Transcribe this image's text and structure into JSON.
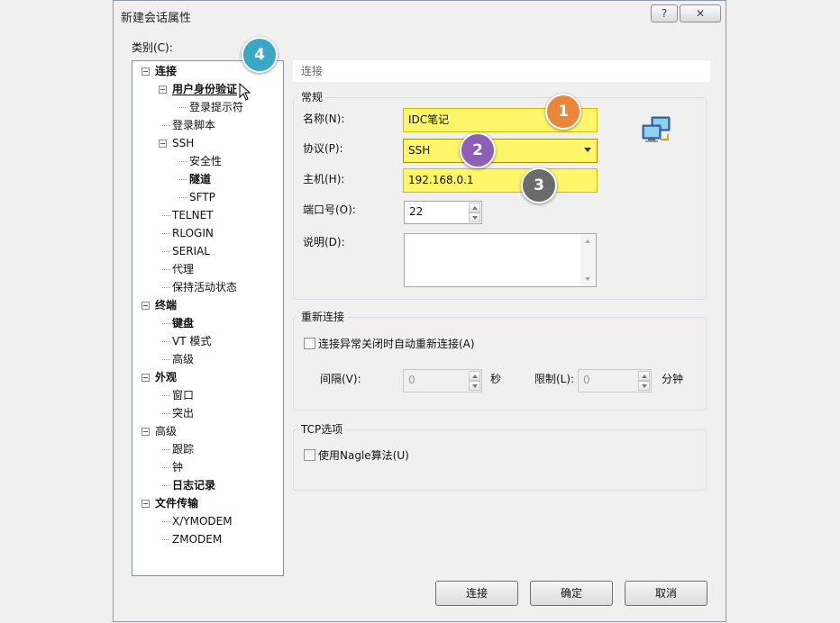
{
  "window": {
    "title": "新建会话属性",
    "help_label": "?",
    "close_label": "✕"
  },
  "category_label": "类别(C):",
  "tree": [
    {
      "label": "连接",
      "level": 0,
      "bold": true,
      "expander": "minus"
    },
    {
      "label": "用户身份验证",
      "level": 1,
      "bold": true,
      "expander": "minus",
      "selected": true
    },
    {
      "label": "登录提示符",
      "level": 2
    },
    {
      "label": "登录脚本",
      "level": 1
    },
    {
      "label": "SSH",
      "level": 1,
      "expander": "minus"
    },
    {
      "label": "安全性",
      "level": 2
    },
    {
      "label": "隧道",
      "level": 2,
      "bold": true
    },
    {
      "label": "SFTP",
      "level": 2
    },
    {
      "label": "TELNET",
      "level": 1
    },
    {
      "label": "RLOGIN",
      "level": 1
    },
    {
      "label": "SERIAL",
      "level": 1
    },
    {
      "label": "代理",
      "level": 1
    },
    {
      "label": "保持活动状态",
      "level": 1
    },
    {
      "label": "终端",
      "level": 0,
      "bold": true,
      "expander": "minus"
    },
    {
      "label": "键盘",
      "level": 1,
      "bold": true
    },
    {
      "label": "VT 模式",
      "level": 1
    },
    {
      "label": "高级",
      "level": 1
    },
    {
      "label": "外观",
      "level": 0,
      "bold": true,
      "expander": "minus"
    },
    {
      "label": "窗口",
      "level": 1
    },
    {
      "label": "突出",
      "level": 1
    },
    {
      "label": "高级",
      "level": 0,
      "expander": "minus"
    },
    {
      "label": "跟踪",
      "level": 1
    },
    {
      "label": "钟",
      "level": 1
    },
    {
      "label": "日志记录",
      "level": 1,
      "bold": true
    },
    {
      "label": "文件传输",
      "level": 0,
      "bold": true,
      "expander": "minus"
    },
    {
      "label": "X/YMODEM",
      "level": 1
    },
    {
      "label": "ZMODEM",
      "level": 1
    }
  ],
  "panel_header": "连接",
  "general": {
    "group_label": "常规",
    "name_label": "名称(N):",
    "name_value": "IDC笔记",
    "protocol_label": "协议(P):",
    "protocol_value": "SSH",
    "host_label": "主机(H):",
    "host_value": "192.168.0.1",
    "port_label": "端口号(O):",
    "port_value": "22",
    "desc_label": "说明(D):",
    "desc_value": ""
  },
  "reconnect": {
    "group_label": "重新连接",
    "auto_label": "连接异常关闭时自动重新连接(A)",
    "interval_label": "间隔(V):",
    "interval_value": "0",
    "interval_unit": "秒",
    "limit_label": "限制(L):",
    "limit_value": "0",
    "limit_unit": "分钟"
  },
  "tcp": {
    "group_label": "TCP选项",
    "nagle_label": "使用Nagle算法(U)"
  },
  "buttons": {
    "connect": "连接",
    "ok": "确定",
    "cancel": "取消"
  },
  "badges": [
    {
      "label": "1",
      "color": "#e8873a"
    },
    {
      "label": "2",
      "color": "#8e5fb5"
    },
    {
      "label": "3",
      "color": "#6b6b6b"
    },
    {
      "label": "4",
      "color": "#3aa7c4"
    }
  ],
  "colors": {
    "highlight": "#fff66b",
    "highlight_border": "#d4bf00"
  }
}
